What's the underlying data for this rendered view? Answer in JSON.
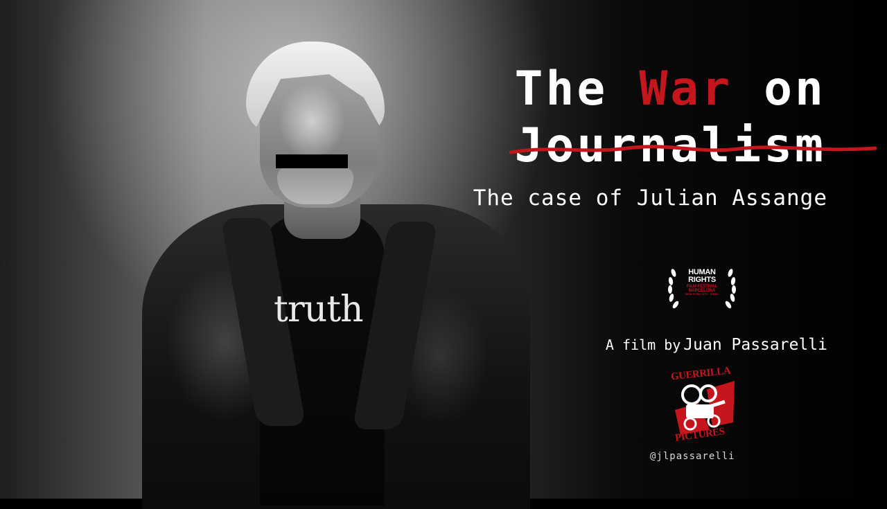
{
  "poster": {
    "title_word_1": "The",
    "title_word_2": "War",
    "title_word_3": "on",
    "title_word_4": "Journalism",
    "subtitle": "The case of Julian Assange",
    "credit_prefix": "A film by",
    "director": "Juan Passarelli",
    "handle": "@jlpassarelli",
    "shirt_text": "truth",
    "accent_color": "#c4161c"
  },
  "festival_laurel": {
    "line1": "HUMAN",
    "line2": "RIGHTS",
    "line3": "FILM FESTIVAL",
    "line4": "BARCELONA",
    "line5": "NEW YORK CITY · PARIS"
  },
  "studio_logo": {
    "top_text": "GUERRILLA",
    "bottom_text": "PICTURES"
  }
}
